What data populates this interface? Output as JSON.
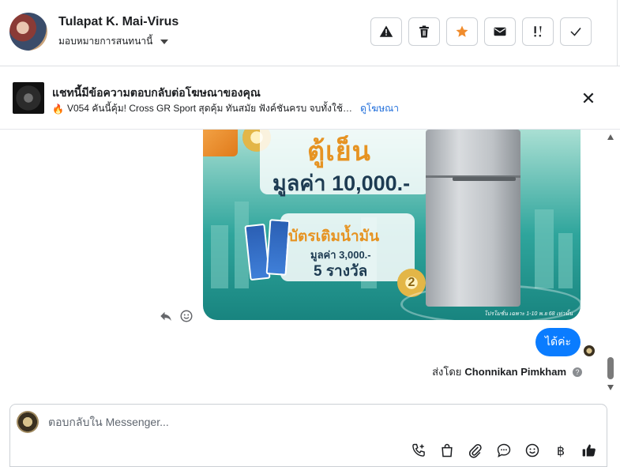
{
  "header": {
    "contact_name": "Tulapat K. Mai-Virus",
    "assign_label": "มอบหมายการสนทนานี้",
    "actions": [
      {
        "icon": "warning-icon"
      },
      {
        "icon": "trash-icon"
      },
      {
        "icon": "star-icon",
        "color": "#f08c2d"
      },
      {
        "icon": "envelope-icon"
      },
      {
        "icon": "important-icon"
      },
      {
        "icon": "check-icon"
      }
    ]
  },
  "ad_banner": {
    "title": "แชทนี้มีข้อความตอบกลับต่อโฆษณาของคุณ",
    "subtitle": "V054 คันนี้คุ้ม! Cross GR Sport สุดคุ้ม ทันสมัย ฟังค์ชันครบ จบทั้งใช้…",
    "view_ad_link": "ดูโฆษณา"
  },
  "promo_image": {
    "headline": "ตู้เย็น",
    "headline_value": "มูลค่า 10,000.-",
    "fuel_title": "บัตรเติมน้ำมัน",
    "fuel_value": "มูลค่า 3,000.-",
    "fuel_count": "5 รางวัล",
    "medal_number": "2",
    "fineprint": "โปรโมชั่น เฉพาะ 1-10 พ.ย 68 เท่านั้น"
  },
  "messages": {
    "outgoing_text": "ได้ค่ะ",
    "sent_by_prefix": "ส่งโดย",
    "sent_by_name": "Chonnikan Pimkham"
  },
  "composer": {
    "placeholder": "ตอบกลับใน Messenger..."
  },
  "colors": {
    "accent": "#0a7cff",
    "link": "#216fdb",
    "star": "#f08c2d"
  }
}
